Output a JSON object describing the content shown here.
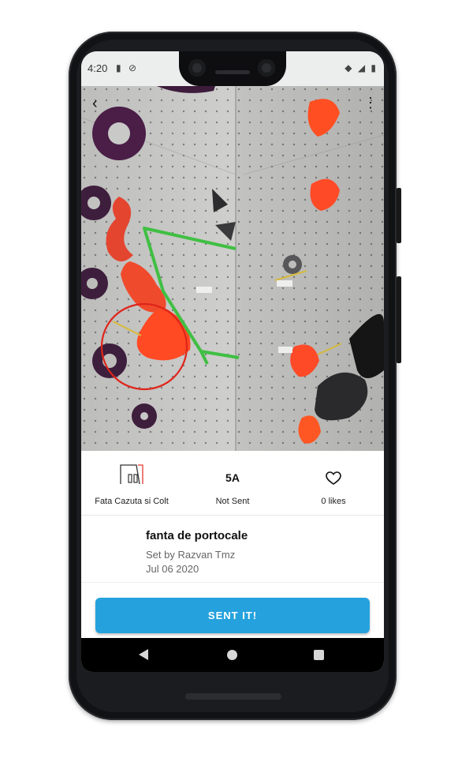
{
  "status_bar": {
    "time": "4:20",
    "left_icons": [
      "sd-card-icon",
      "sync-icon"
    ],
    "right_icons": [
      "wifi-icon",
      "signal-icon",
      "battery-icon"
    ]
  },
  "toolbar": {
    "back_icon": "back-arrow-icon",
    "menu_icon": "more-vertical-icon"
  },
  "photo": {
    "description_icons": [
      "route-line",
      "selected-hold-circle"
    ],
    "colors": {
      "hold_accent": "#ff3b1f",
      "route_line": "#3fbf3f",
      "selection_circle": "#e0241a"
    }
  },
  "route_info": {
    "wall": {
      "icon": "wall-icon",
      "label": "Fata Cazuta si Colt"
    },
    "grade": {
      "value": "5A",
      "label": "Not Sent"
    },
    "likes": {
      "icon": "heart-icon",
      "label": "0 likes"
    }
  },
  "route_details": {
    "name": "fanta de portocale",
    "setter": "Set by Razvan Tmz",
    "date": "Jul 06 2020"
  },
  "actions": {
    "sent_label": "SENT IT!",
    "accent_color": "#25a2dd"
  },
  "nav_bar": {
    "items": [
      "back-triangle-icon",
      "home-circle-icon",
      "recents-square-icon"
    ]
  }
}
